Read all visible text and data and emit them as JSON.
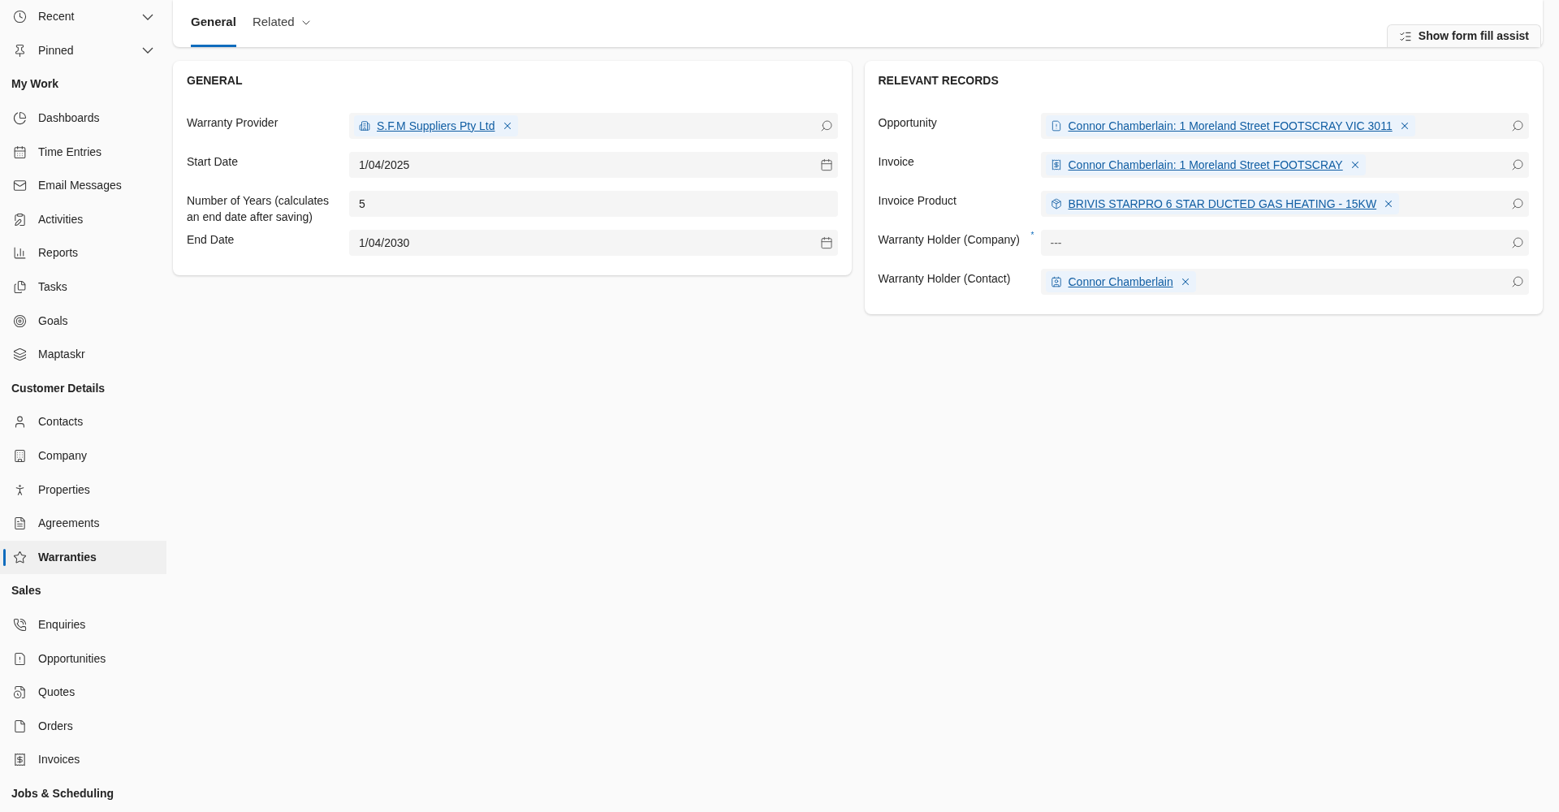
{
  "sidebar": {
    "items": [
      {
        "kind": "group",
        "label": "Recent",
        "expanded": false
      },
      {
        "kind": "group",
        "label": "Pinned",
        "expanded": false
      },
      {
        "kind": "header",
        "label": "My Work"
      },
      {
        "kind": "item",
        "label": "Dashboards",
        "selected": false
      },
      {
        "kind": "item",
        "label": "Time Entries",
        "selected": false
      },
      {
        "kind": "item",
        "label": "Email Messages",
        "selected": false
      },
      {
        "kind": "item",
        "label": "Activities",
        "selected": false
      },
      {
        "kind": "item",
        "label": "Reports",
        "selected": false
      },
      {
        "kind": "item",
        "label": "Tasks",
        "selected": false
      },
      {
        "kind": "item",
        "label": "Goals",
        "selected": false
      },
      {
        "kind": "item",
        "label": "Maptaskr",
        "selected": false
      },
      {
        "kind": "header",
        "label": "Customer Details"
      },
      {
        "kind": "item",
        "label": "Contacts",
        "selected": false
      },
      {
        "kind": "item",
        "label": "Company",
        "selected": false
      },
      {
        "kind": "item",
        "label": "Properties",
        "selected": false
      },
      {
        "kind": "item",
        "label": "Agreements",
        "selected": false
      },
      {
        "kind": "item",
        "label": "Warranties",
        "selected": true
      },
      {
        "kind": "header",
        "label": "Sales"
      },
      {
        "kind": "item",
        "label": "Enquiries",
        "selected": false
      },
      {
        "kind": "item",
        "label": "Opportunities",
        "selected": false
      },
      {
        "kind": "item",
        "label": "Quotes",
        "selected": false
      },
      {
        "kind": "item",
        "label": "Orders",
        "selected": false
      },
      {
        "kind": "item",
        "label": "Invoices",
        "selected": false
      },
      {
        "kind": "header",
        "label": "Jobs & Scheduling"
      }
    ]
  },
  "tabs": [
    {
      "label": "General",
      "selected": true,
      "dropdown": false
    },
    {
      "label": "Related",
      "selected": false,
      "dropdown": true
    }
  ],
  "assist_button": "Show form fill assist",
  "sections": [
    {
      "title": "GENERAL",
      "fields": [
        {
          "kind": "lookup",
          "label": "Warranty Provider",
          "value": "S.F.M Suppliers Pty Ltd"
        },
        {
          "kind": "date",
          "label": "Start Date",
          "value": "1/04/2025"
        },
        {
          "kind": "text",
          "label": "Number of Years (calculates an end date after saving)",
          "value": "5"
        },
        {
          "kind": "date",
          "label": "End Date",
          "value": "1/04/2030"
        }
      ]
    },
    {
      "title": "RELEVANT RECORDS",
      "fields": [
        {
          "kind": "lookup",
          "label": "Opportunity",
          "value": "Connor Chamberlain: 1 Moreland Street FOOTSCRAY VIC 3011"
        },
        {
          "kind": "lookup",
          "label": "Invoice",
          "value": "Connor Chamberlain: 1 Moreland Street FOOTSCRAY"
        },
        {
          "kind": "lookup",
          "label": "Invoice Product",
          "value": "BRIVIS STARPRO 6 STAR DUCTED GAS HEATING - 15KW"
        },
        {
          "kind": "lookup",
          "label": "Warranty Holder (Company)",
          "required_mark": "*",
          "placeholder": "---"
        },
        {
          "kind": "lookup",
          "label": "Warranty Holder (Contact)",
          "value": "Connor Chamberlain"
        }
      ]
    }
  ]
}
